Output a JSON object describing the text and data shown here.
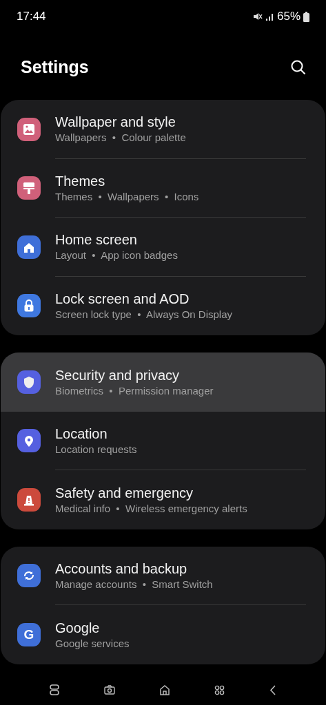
{
  "status_bar": {
    "time": "17:44",
    "battery": "65%"
  },
  "header": {
    "title": "Settings"
  },
  "groups": [
    {
      "items": [
        {
          "title": "Wallpaper and style",
          "subtitle": "Wallpapers  •  Colour palette",
          "selected": false
        },
        {
          "title": "Themes",
          "subtitle": "Themes  •  Wallpapers  •  Icons",
          "icon": {
            "kind": "brush",
            "color": "#d0607a"
          },
          "selected": false
        },
        {
          "title": "Home screen",
          "subtitle": "Layout  •  App icon badges",
          "icon": {
            "kind": "home",
            "color": "#3f6fd8"
          },
          "selected": false
        },
        {
          "title": "Lock screen and AOD",
          "subtitle": "Screen lock type  •  Always On Display",
          "icon": {
            "kind": "lock",
            "color": "#3f78e0"
          },
          "selected": false
        }
      ]
    },
    {
      "items": [
        {
          "title": "Security and privacy",
          "subtitle": "Biometrics  •  Permission manager",
          "icon": {
            "kind": "shield",
            "color": "#5560e0"
          },
          "selected": true
        },
        {
          "title": "Location",
          "subtitle": "Location requests",
          "icon": {
            "kind": "pin",
            "color": "#5560e0"
          },
          "selected": false
        },
        {
          "title": "Safety and emergency",
          "subtitle": "Medical info  •  Wireless emergency alerts",
          "icon": {
            "kind": "alert",
            "color": "#cc4a3c"
          },
          "selected": false
        }
      ]
    },
    {
      "items": [
        {
          "title": "Accounts and backup",
          "subtitle": "Manage accounts  •  Smart Switch",
          "icon": {
            "kind": "sync",
            "color": "#3f6fd8"
          },
          "selected": false
        },
        {
          "title": "Google",
          "subtitle": "Google services",
          "icon": {
            "kind": "letter",
            "color": "#3f6fd8",
            "glyph": "G"
          },
          "selected": false
        }
      ]
    }
  ]
}
